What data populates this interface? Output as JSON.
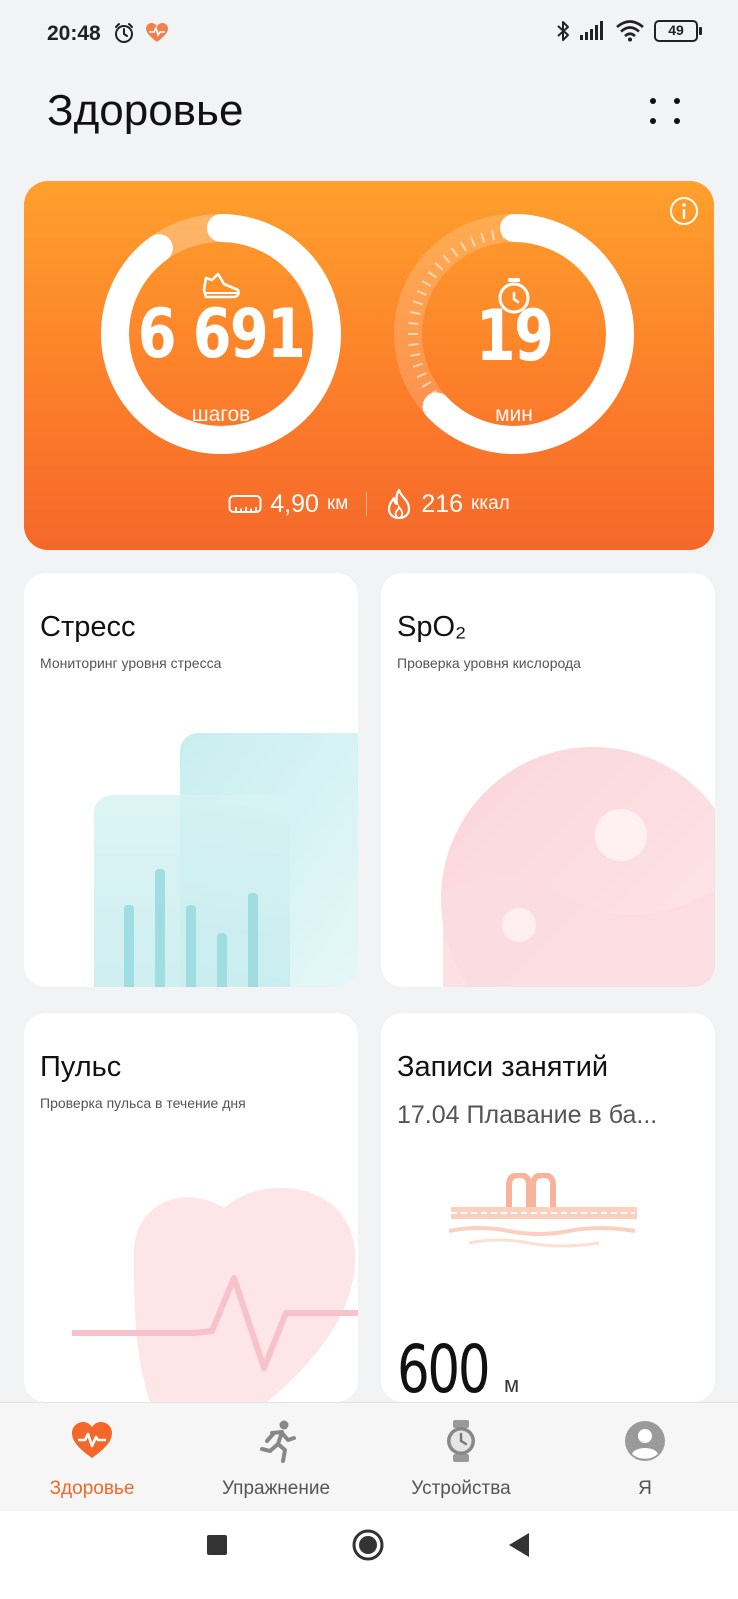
{
  "status_bar": {
    "time": "20:48",
    "left_icons": [
      "alarm-icon",
      "health-app-icon"
    ],
    "right_icons": [
      "bluetooth-icon",
      "signal-icon",
      "wifi-icon"
    ],
    "battery": "49"
  },
  "header": {
    "title": "Здоровье",
    "more_icon": "more-dots-icon"
  },
  "activity": {
    "steps_value": "6 691",
    "steps_unit": "шагов",
    "steps_progress": 0.9,
    "minutes_value": "19",
    "minutes_unit": "мин",
    "minutes_progress": 0.63,
    "distance_value": "4,90",
    "distance_unit": "км",
    "calories_value": "216",
    "calories_unit": "ккал",
    "colors": {
      "gradient_top": "#ffa02c",
      "gradient_bottom": "#f5682a"
    }
  },
  "tiles": {
    "stress": {
      "title": "Стресс",
      "subtitle": "Мониторинг уровня стресса"
    },
    "spo2": {
      "title": "SpO₂",
      "subtitle": "Проверка уровня кислорода"
    },
    "pulse": {
      "title": "Пульс",
      "subtitle": "Проверка пульса в течение дня"
    },
    "workouts": {
      "title": "Записи занятий",
      "subtitle": "17.04 Плавание в ба...",
      "value": "600",
      "unit": "м"
    }
  },
  "bottom_nav": {
    "active_color": "#f5662b",
    "items": [
      {
        "label": "Здоровье",
        "icon": "heart-pulse-icon"
      },
      {
        "label": "Упражнение",
        "icon": "running-icon"
      },
      {
        "label": "Устройства",
        "icon": "watch-icon"
      },
      {
        "label": "Я",
        "icon": "profile-icon"
      }
    ]
  },
  "system_nav": {
    "icons": [
      "recents-icon",
      "home-icon",
      "back-icon"
    ]
  }
}
